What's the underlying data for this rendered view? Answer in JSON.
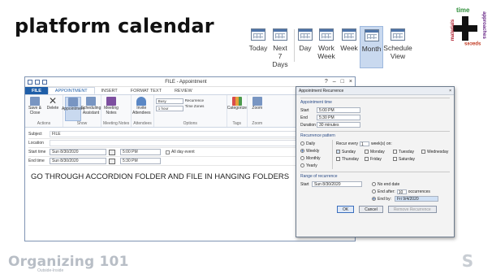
{
  "slide": {
    "title": "platform calendar"
  },
  "corner_logo": {
    "time": "time",
    "materials": "materials",
    "approaches": "approaches",
    "spaces": "spaces"
  },
  "view_ribbon": {
    "buttons": [
      {
        "label": "Today",
        "icon": "calendar-today-icon",
        "active": false
      },
      {
        "label": "Next 7 Days",
        "icon": "calendar-week-icon",
        "active": false
      },
      {
        "label": "Day",
        "icon": "calendar-day-icon",
        "active": false
      },
      {
        "label": "Work Week",
        "icon": "calendar-workweek-icon",
        "active": false
      },
      {
        "label": "Week",
        "icon": "calendar-week-view-icon",
        "active": false
      },
      {
        "label": "Month",
        "icon": "calendar-month-icon",
        "active": true
      },
      {
        "label": "Schedule View",
        "icon": "schedule-view-icon",
        "active": false
      }
    ]
  },
  "outlook": {
    "window_title": "FILE - Appointment",
    "tabs": [
      "FILE",
      "APPOINTMENT",
      "INSERT",
      "FORMAT TEXT",
      "REVIEW"
    ],
    "active_tab": "APPOINTMENT",
    "ribbon": {
      "save_close": "Save & Close",
      "delete": "Delete",
      "actions_label": "Actions",
      "appointment": "Appointment",
      "scheduling": "Scheduling Assistant",
      "show_label": "Show",
      "meeting_notes": "Meeting Notes",
      "meeting_notes_label": "Meeting Notes",
      "invite": "Invite Attendees",
      "attendees_label": "Attendees",
      "busy": "Busy",
      "reminder": "1 hour",
      "recurrence": "Recurrence",
      "time_zones": "Time Zones",
      "options_label": "Options",
      "categorize": "Categorize",
      "tags_label": "Tags",
      "zoom": "Zoom",
      "zoom_label": "Zoom"
    },
    "form": {
      "subject_label": "Subject",
      "subject_value": "FILE",
      "location_label": "Location",
      "start_label": "Start time",
      "start_date": "Sun 8/30/2020",
      "start_time": "5:00 PM",
      "all_day": "All day event",
      "end_label": "End time",
      "end_date": "Sun 8/30/2020",
      "end_time": "5:30 PM",
      "body": "GO THROUGH ACCORDION FOLDER AND FILE IN HANGING FOLDERS"
    }
  },
  "recurrence_dialog": {
    "title": "Appointment Recurrence",
    "close": "×",
    "time_title": "Appointment time",
    "start_label": "Start",
    "start_value": "5:00 PM",
    "end_label": "End",
    "end_value": "5:30 PM",
    "duration_label": "Duration",
    "duration_value": "30 minutes",
    "pattern_title": "Recurrence pattern",
    "patterns": [
      {
        "label": "Daily",
        "on": false
      },
      {
        "label": "Weekly",
        "on": true
      },
      {
        "label": "Monthly",
        "on": false
      },
      {
        "label": "Yearly",
        "on": false
      }
    ],
    "recur_every": "Recur every",
    "recur_value": "1",
    "weeks_on": "week(s) on:",
    "days": [
      {
        "label": "Sunday",
        "on": true
      },
      {
        "label": "Monday",
        "on": false
      },
      {
        "label": "Tuesday",
        "on": false
      },
      {
        "label": "Wednesday",
        "on": false
      },
      {
        "label": "Thursday",
        "on": false
      },
      {
        "label": "Friday",
        "on": false
      },
      {
        "label": "Saturday",
        "on": false
      }
    ],
    "range_title": "Range of recurrence",
    "range_start_label": "Start",
    "range_start_value": "Sun 8/30/2020",
    "no_end": "No end date",
    "end_after": "End after:",
    "end_after_value": "10",
    "occurrences": "occurrences",
    "end_by": "End by:",
    "end_by_value": "Fri 9/4/2020",
    "ok": "OK",
    "cancel": "Cancel",
    "remove": "Remove Recurrence"
  },
  "footer": {
    "brand": "Organizing 101",
    "brand_sub": "Outside-Inside",
    "logo_letter": "S"
  }
}
